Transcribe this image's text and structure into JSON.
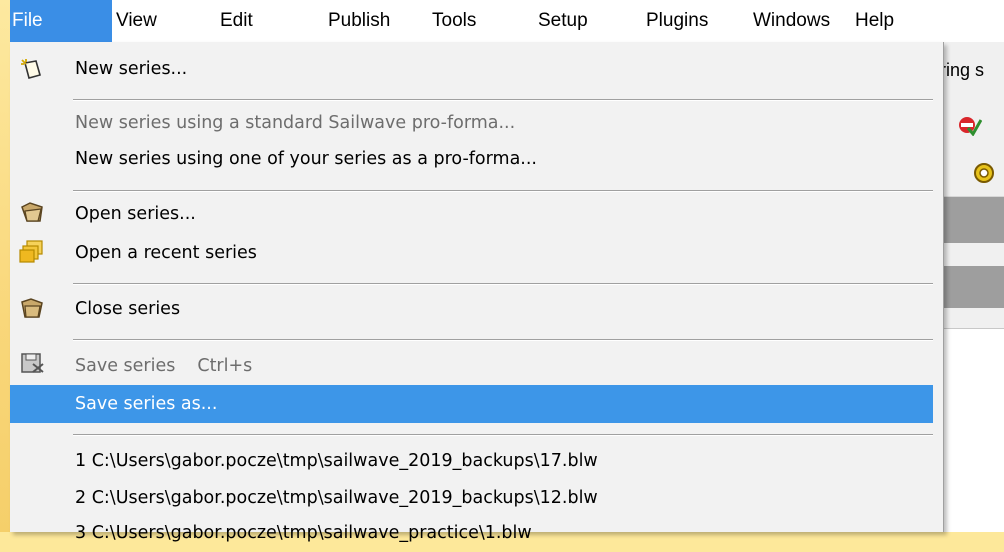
{
  "menubar": {
    "items": [
      "File",
      "View",
      "Edit",
      "Publish",
      "Tools",
      "Setup",
      "Plugins",
      "Windows",
      "Help"
    ]
  },
  "background": {
    "partial_text": "ring s"
  },
  "file_menu": {
    "new_series": "New series...",
    "new_standard": "New series using a standard Sailwave pro-forma...",
    "new_yours": "New series using one of your series as a pro-forma...",
    "open_series": "Open series...",
    "open_recent": "Open a recent series",
    "close_series": "Close series",
    "save_series": "Save series",
    "save_shortcut": "Ctrl+s",
    "save_as": "Save series as...",
    "recent": [
      "1 C:\\Users\\gabor.pocze\\tmp\\sailwave_2019_backups\\17.blw",
      "2 C:\\Users\\gabor.pocze\\tmp\\sailwave_2019_backups\\12.blw",
      "3 C:\\Users\\gabor.pocze\\tmp\\sailwave_practice\\1.blw"
    ]
  },
  "colors": {
    "highlight": "#3d96e8",
    "frame": "#fde89a"
  }
}
